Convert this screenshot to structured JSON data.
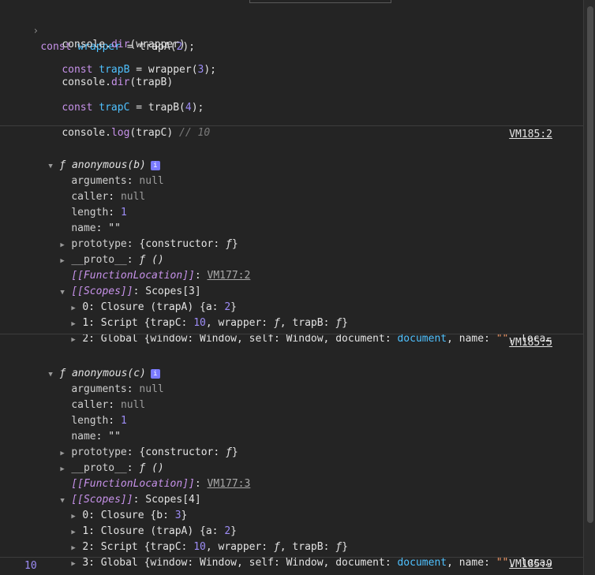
{
  "input": {
    "prompt": "›",
    "lines": [
      {
        "kw": "const",
        "name": "wrapper",
        "eq": " = ",
        "call": "trapA(",
        "num": "2",
        "end": ");"
      },
      {
        "plain": "console.",
        "method": "dir",
        "rest": "(wrapper)"
      },
      {
        "kw": "const",
        "name": "trapB",
        "eq": " = ",
        "call": "wrapper(",
        "num": "3",
        "end": ");"
      },
      {
        "plain": "console.",
        "method": "dir",
        "rest": "(trapB)"
      },
      {
        "kw": "const",
        "name": "trapC",
        "eq": " = ",
        "call": "trapB(",
        "num": "4",
        "end": ");"
      },
      {
        "plain": "console.",
        "method": "log",
        "rest": "(trapC) ",
        "comment": "// 10"
      }
    ]
  },
  "outputs": [
    {
      "source": "VM185:2",
      "header": "anonymous(b)",
      "fsym": "ƒ",
      "arguments": {
        "k": "arguments",
        "v": "null"
      },
      "caller": {
        "k": "caller",
        "v": "null"
      },
      "length": {
        "k": "length",
        "v": "1"
      },
      "name": {
        "k": "name",
        "v": "\"\""
      },
      "prototype": {
        "k": "prototype",
        "v": "{constructor: ",
        "f": "ƒ",
        "close": "}"
      },
      "proto": {
        "k": "__proto__",
        "v": "ƒ ()"
      },
      "location": {
        "k": "[[FunctionLocation]]",
        "v": "VM177:2"
      },
      "scopes": {
        "k": "[[Scopes]]",
        "v": "Scopes[3]"
      },
      "scope_items": [
        {
          "idx": "0",
          "label": "Closure (trapA) {a: ",
          "num": "2",
          "end": "}"
        },
        {
          "idx": "1",
          "label": "Script {trapC: ",
          "num": "10",
          "mid": ", wrapper: ",
          "f1": "ƒ",
          "mid2": ", trapB: ",
          "f2": "ƒ",
          "end": "}"
        },
        {
          "idx": "2",
          "label": "Global {window: Window, self: Window, document: ",
          "doc": "document",
          "mid": ", name: ",
          "str": "\"\"",
          "end": ", loca…"
        }
      ]
    },
    {
      "source": "VM185:5",
      "header": "anonymous(c)",
      "fsym": "ƒ",
      "arguments": {
        "k": "arguments",
        "v": "null"
      },
      "caller": {
        "k": "caller",
        "v": "null"
      },
      "length": {
        "k": "length",
        "v": "1"
      },
      "name": {
        "k": "name",
        "v": "\"\""
      },
      "prototype": {
        "k": "prototype",
        "v": "{constructor: ",
        "f": "ƒ",
        "close": "}"
      },
      "proto": {
        "k": "__proto__",
        "v": "ƒ ()"
      },
      "location": {
        "k": "[[FunctionLocation]]",
        "v": "VM177:3"
      },
      "scopes": {
        "k": "[[Scopes]]",
        "v": "Scopes[4]"
      },
      "scope_items": [
        {
          "idx": "0",
          "label": "Closure {b: ",
          "num": "3",
          "end": "}"
        },
        {
          "idx": "1",
          "label": "Closure (trapA) {a: ",
          "num": "2",
          "end": "}"
        },
        {
          "idx": "2",
          "label": "Script {trapC: ",
          "num": "10",
          "mid": ", wrapper: ",
          "f1": "ƒ",
          "mid2": ", trapB: ",
          "f2": "ƒ",
          "end": "}"
        },
        {
          "idx": "3",
          "label": "Global {window: Window, self: Window, document: ",
          "doc": "document",
          "mid": ", name: ",
          "str": "\"\"",
          "end": ", loca…"
        }
      ]
    }
  ],
  "log": {
    "value": "10",
    "source": "VM185:9"
  },
  "badge_glyph": "i"
}
